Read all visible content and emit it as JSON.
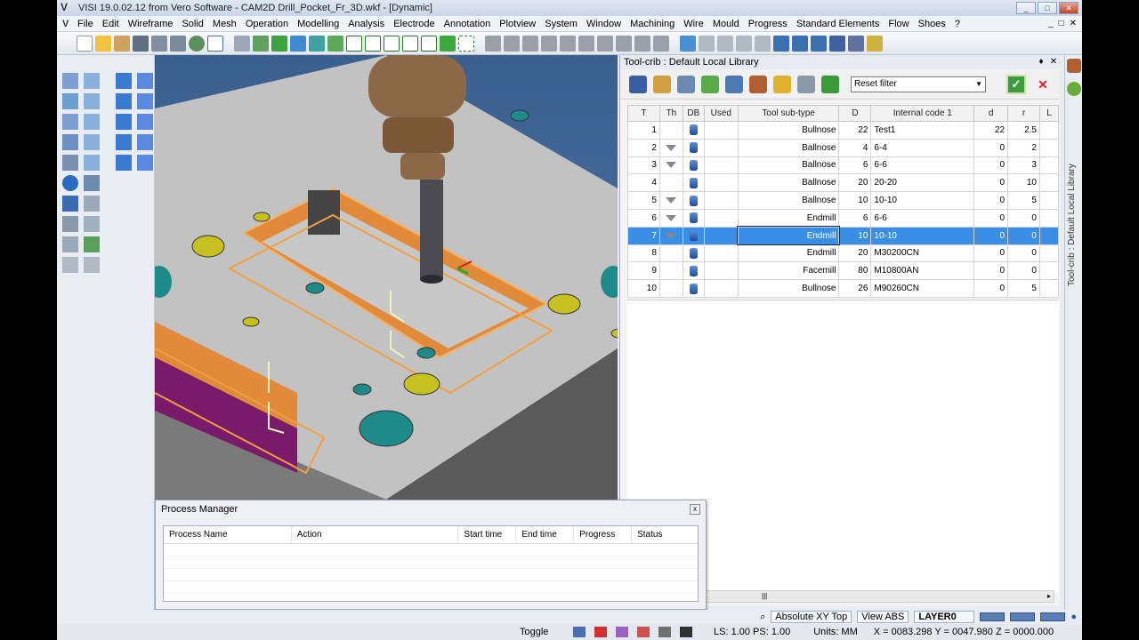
{
  "window": {
    "title": "VISI 19.0.02.12 from Vero Software - CAM2D Drill_Pocket_Fr_3D.wkf - [Dynamic]",
    "logo": "V",
    "controls": [
      "_",
      "□",
      "✕"
    ]
  },
  "menu": {
    "items": [
      "File",
      "Edit",
      "Wireframe",
      "Solid",
      "Mesh",
      "Operation",
      "Modelling",
      "Analysis",
      "Electrode",
      "Annotation",
      "Plotview",
      "System",
      "Window",
      "Machining",
      "Wire",
      "Mould",
      "Progress",
      "Standard Elements",
      "Flow",
      "Shoes",
      "?"
    ],
    "right_controls": [
      "_",
      "□",
      "✕"
    ]
  },
  "toolcrib": {
    "title": "Tool-crib : Default Local Library",
    "pin": "♦",
    "close": "✕",
    "filter": "Reset filter",
    "ok": "✓",
    "cancel": "✕",
    "columns": [
      "T",
      "Th",
      "DB",
      "Used",
      "Tool sub-type",
      "D",
      "Internal code 1",
      "d",
      "r",
      "L"
    ],
    "rows": [
      {
        "t": "1",
        "th": false,
        "subtype": "Bullnose",
        "D": "22",
        "code": "Test1",
        "d": "22",
        "r": "2.5"
      },
      {
        "t": "2",
        "th": true,
        "subtype": "Ballnose",
        "D": "4",
        "code": "6-4",
        "d": "0",
        "r": "2"
      },
      {
        "t": "3",
        "th": true,
        "subtype": "Ballnose",
        "D": "6",
        "code": "6-6",
        "d": "0",
        "r": "3"
      },
      {
        "t": "4",
        "th": false,
        "subtype": "Ballnose",
        "D": "20",
        "code": "20-20",
        "d": "0",
        "r": "10"
      },
      {
        "t": "5",
        "th": true,
        "subtype": "Ballnose",
        "D": "10",
        "code": "10-10",
        "d": "0",
        "r": "5"
      },
      {
        "t": "6",
        "th": true,
        "subtype": "Endmill",
        "D": "6",
        "code": "6-6",
        "d": "0",
        "r": "0"
      },
      {
        "t": "7",
        "th": true,
        "subtype": "Endmill",
        "D": "10",
        "code": "10-10",
        "d": "0",
        "r": "0",
        "selected": true
      },
      {
        "t": "8",
        "th": false,
        "subtype": "Endmill",
        "D": "20",
        "code": "M30200CN",
        "d": "0",
        "r": "0"
      },
      {
        "t": "9",
        "th": false,
        "subtype": "Facemill",
        "D": "80",
        "code": "M10800AN",
        "d": "0",
        "r": "0"
      },
      {
        "t": "10",
        "th": false,
        "subtype": "Bullnose",
        "D": "26",
        "code": "M90260CN",
        "d": "0",
        "r": "5"
      }
    ],
    "side_tab": "Tool-crib : Default Local Library"
  },
  "process_manager": {
    "title": "Process Manager",
    "close": "x",
    "columns": [
      "Process Name",
      "Action",
      "Start time",
      "End time",
      "Progress",
      "Status"
    ]
  },
  "status": {
    "view_mode": "Absolute XY Top",
    "view_abs": "View ABS",
    "layer": "LAYER0",
    "toggle": "Toggle",
    "ls_ps": "LS: 1.00 PS: 1.00",
    "units": "Units: MM",
    "coords": "X = 0083.298 Y = 0047.980 Z = 0000.000"
  },
  "colors": {
    "viewport_bg": "#4a6fa0",
    "part_top": "#c8c8c8",
    "pocket_orange": "#e08a3a",
    "hole_teal": "#1f8a8a",
    "hole_yellow": "#c8c020",
    "side_purple": "#7a1a6a",
    "selection_blue": "#3a8ee6"
  }
}
